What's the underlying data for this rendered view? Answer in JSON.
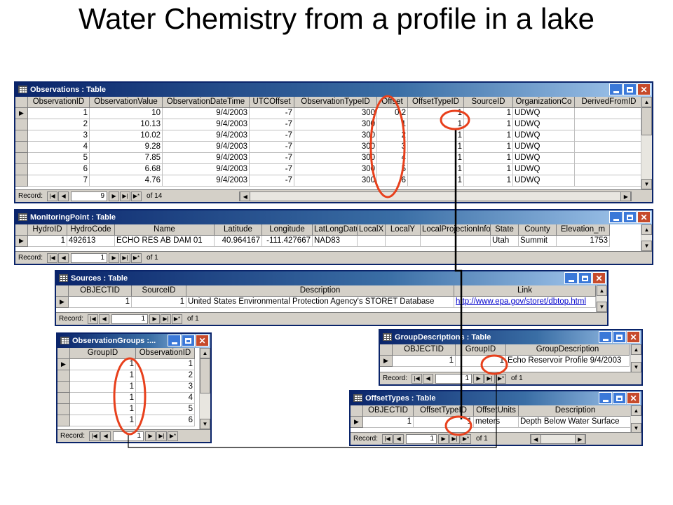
{
  "slide": {
    "title": "Water Chemistry from a profile in a lake"
  },
  "nav": {
    "record_label": "Record:",
    "btn_first": "|◀",
    "btn_prev": "◀",
    "btn_next": "▶",
    "btn_last": "▶|",
    "btn_new": "▶*"
  },
  "observations": {
    "title": "Observations : Table",
    "columns": [
      "ObservationID",
      "ObservationValue",
      "ObservationDateTime",
      "UTCOffset",
      "ObservationTypeID",
      "Offset",
      "OffsetTypeID",
      "SourceID",
      "OrganizationCo",
      "DerivedFromID"
    ],
    "rows": [
      [
        "1",
        "10",
        "9/4/2003",
        "-7",
        "300",
        "0.2",
        "1",
        "1",
        "UDWQ",
        ""
      ],
      [
        "2",
        "10.13",
        "9/4/2003",
        "-7",
        "300",
        "1",
        "1",
        "1",
        "UDWQ",
        ""
      ],
      [
        "3",
        "10.02",
        "9/4/2003",
        "-7",
        "300",
        "2",
        "1",
        "1",
        "UDWQ",
        ""
      ],
      [
        "4",
        "9.28",
        "9/4/2003",
        "-7",
        "300",
        "3",
        "1",
        "1",
        "UDWQ",
        ""
      ],
      [
        "5",
        "7.85",
        "9/4/2003",
        "-7",
        "300",
        "4",
        "1",
        "1",
        "UDWQ",
        ""
      ],
      [
        "6",
        "6.68",
        "9/4/2003",
        "-7",
        "300",
        "5",
        "1",
        "1",
        "UDWQ",
        ""
      ],
      [
        "7",
        "4.76",
        "9/4/2003",
        "-7",
        "300",
        "6",
        "1",
        "1",
        "UDWQ",
        ""
      ]
    ],
    "record": "9",
    "of": "of 14"
  },
  "monitoring": {
    "title": "MonitoringPoint : Table",
    "columns": [
      "HydroID",
      "HydroCode",
      "Name",
      "Latitude",
      "Longitude",
      "LatLongDatum",
      "LocalX",
      "LocalY",
      "LocalProjectionInfo",
      "State",
      "County",
      "Elevation_m"
    ],
    "rows": [
      [
        "1",
        "492613",
        "ECHO RES AB DAM 01",
        "40.964167",
        "-111.427667",
        "NAD83",
        "",
        "",
        "",
        "Utah",
        "Summit",
        "1753"
      ]
    ],
    "record": "1",
    "of": "of 1"
  },
  "sources": {
    "title": "Sources : Table",
    "columns": [
      "OBJECTID",
      "SourceID",
      "Description",
      "Link"
    ],
    "rows": [
      [
        "1",
        "1",
        "United States Environmental Protection Agency's STORET Database",
        "http://www.epa.gov/storet/dbtop.html"
      ]
    ],
    "record": "1",
    "of": "of 1"
  },
  "obsgroups": {
    "title": "ObservationGroups :...",
    "columns": [
      "GroupID",
      "ObservationID"
    ],
    "rows": [
      [
        "1",
        "1"
      ],
      [
        "1",
        "2"
      ],
      [
        "1",
        "3"
      ],
      [
        "1",
        "4"
      ],
      [
        "1",
        "5"
      ],
      [
        "1",
        "6"
      ]
    ],
    "record": "1"
  },
  "groupdesc": {
    "title": "GroupDescriptions : Table",
    "columns": [
      "OBJECTID",
      "GroupID",
      "GroupDescription"
    ],
    "rows": [
      [
        "1",
        "1",
        "Echo Reservoir Profile 9/4/2003"
      ]
    ],
    "record": "1",
    "of": "of 1"
  },
  "offsettypes": {
    "title": "OffsetTypes : Table",
    "columns": [
      "OBJECTID",
      "OffsetTypeID",
      "OffsetUnits",
      "Description"
    ],
    "rows": [
      [
        "1",
        "1",
        "meters",
        "Depth Below Water Surface"
      ]
    ],
    "record": "1",
    "of": "of 1"
  },
  "annotation_color": "#e8401c",
  "connector_color": "#000000"
}
